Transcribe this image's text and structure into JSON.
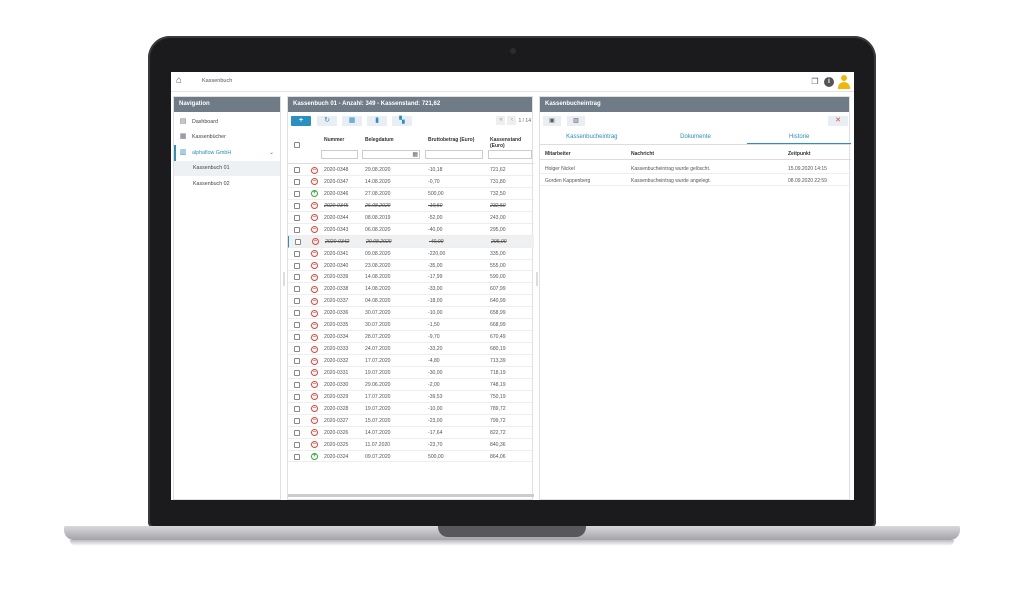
{
  "topbar": {
    "breadcrumb": "Kassenbuch"
  },
  "navigation": {
    "title": "Navigation",
    "items": [
      {
        "label": "Dashboard",
        "icon": "dashboard-icon"
      },
      {
        "label": "Kassenbücher",
        "icon": "cash-register-icon"
      },
      {
        "label": "alphaflow GmbH",
        "icon": "building-icon"
      },
      {
        "label": "Kassenbuch 01",
        "icon": ""
      },
      {
        "label": "Kassenbuch 02",
        "icon": ""
      }
    ]
  },
  "main": {
    "title": "Kassenbuch 01 - Anzahl: 349 - Kassenstand: 721,62",
    "pager": "1 / 14",
    "columns": [
      "Nummer",
      "Belegdatum",
      "Bruttobetrag (Euro)",
      "Kassenstand (Euro)"
    ],
    "rows": [
      {
        "nr": "2020-0348",
        "datum": "29.08.2020",
        "betrag": "-10,18",
        "stand": "721,62",
        "type": "minus",
        "strike": false,
        "sel": false
      },
      {
        "nr": "2020-0347",
        "datum": "14.08.2020",
        "betrag": "-0,70",
        "stand": "731,80",
        "type": "minus",
        "strike": false,
        "sel": false
      },
      {
        "nr": "2020-0346",
        "datum": "27.08.2020",
        "betrag": "500,00",
        "stand": "732,50",
        "type": "plus",
        "strike": false,
        "sel": false
      },
      {
        "nr": "2020-0345",
        "datum": "26.08.2020",
        "betrag": "-10,50",
        "stand": "232,50",
        "type": "minus",
        "strike": true,
        "sel": false
      },
      {
        "nr": "2020-0344",
        "datum": "08.08.2019",
        "betrag": "-52,00",
        "stand": "243,00",
        "type": "minus",
        "strike": false,
        "sel": false
      },
      {
        "nr": "2020-0343",
        "datum": "06.08.2020",
        "betrag": "-40,00",
        "stand": "295,00",
        "type": "minus",
        "strike": false,
        "sel": false
      },
      {
        "nr": "2020-0342",
        "datum": "20.08.2020",
        "betrag": "-40,00",
        "stand": "295,00",
        "type": "minus",
        "strike": true,
        "sel": true
      },
      {
        "nr": "2020-0341",
        "datum": "09.08.2020",
        "betrag": "-220,00",
        "stand": "335,00",
        "type": "minus",
        "strike": false,
        "sel": false
      },
      {
        "nr": "2020-0340",
        "datum": "23.08.2020",
        "betrag": "-35,00",
        "stand": "555,00",
        "type": "minus",
        "strike": false,
        "sel": false
      },
      {
        "nr": "2020-0339",
        "datum": "14.08.2020",
        "betrag": "-17,99",
        "stand": "590,00",
        "type": "minus",
        "strike": false,
        "sel": false
      },
      {
        "nr": "2020-0338",
        "datum": "14.08.2020",
        "betrag": "-33,00",
        "stand": "607,99",
        "type": "minus",
        "strike": false,
        "sel": false
      },
      {
        "nr": "2020-0337",
        "datum": "04.08.2020",
        "betrag": "-18,00",
        "stand": "640,99",
        "type": "minus",
        "strike": false,
        "sel": false
      },
      {
        "nr": "2020-0336",
        "datum": "30.07.2020",
        "betrag": "-10,00",
        "stand": "658,99",
        "type": "minus",
        "strike": false,
        "sel": false
      },
      {
        "nr": "2020-0335",
        "datum": "30.07.2020",
        "betrag": "-1,50",
        "stand": "668,99",
        "type": "minus",
        "strike": false,
        "sel": false
      },
      {
        "nr": "2020-0334",
        "datum": "28.07.2020",
        "betrag": "-9,70",
        "stand": "670,49",
        "type": "minus",
        "strike": false,
        "sel": false
      },
      {
        "nr": "2020-0333",
        "datum": "24.07.2020",
        "betrag": "-33,20",
        "stand": "680,19",
        "type": "minus",
        "strike": false,
        "sel": false
      },
      {
        "nr": "2020-0332",
        "datum": "17.07.2020",
        "betrag": "-4,80",
        "stand": "713,39",
        "type": "minus",
        "strike": false,
        "sel": false
      },
      {
        "nr": "2020-0331",
        "datum": "19.07.2020",
        "betrag": "-30,00",
        "stand": "718,19",
        "type": "minus",
        "strike": false,
        "sel": false
      },
      {
        "nr": "2020-0330",
        "datum": "29.06.2020",
        "betrag": "-2,00",
        "stand": "748,19",
        "type": "minus",
        "strike": false,
        "sel": false
      },
      {
        "nr": "2020-0329",
        "datum": "17.07.2020",
        "betrag": "-39,53",
        "stand": "750,19",
        "type": "minus",
        "strike": false,
        "sel": false
      },
      {
        "nr": "2020-0328",
        "datum": "19.07.2020",
        "betrag": "-10,00",
        "stand": "789,72",
        "type": "minus",
        "strike": false,
        "sel": false
      },
      {
        "nr": "2020-0327",
        "datum": "15.07.2020",
        "betrag": "-23,00",
        "stand": "799,72",
        "type": "minus",
        "strike": false,
        "sel": false
      },
      {
        "nr": "2020-0326",
        "datum": "14.07.2020",
        "betrag": "-17,64",
        "stand": "822,72",
        "type": "minus",
        "strike": false,
        "sel": false
      },
      {
        "nr": "2020-0325",
        "datum": "11.07.2020",
        "betrag": "-23,70",
        "stand": "840,36",
        "type": "minus",
        "strike": false,
        "sel": false
      },
      {
        "nr": "2020-0324",
        "datum": "09.07.2020",
        "betrag": "500,00",
        "stand": "864,06",
        "type": "plus",
        "strike": false,
        "sel": false
      }
    ]
  },
  "detail": {
    "title": "Kassenbucheintrag",
    "tabs": [
      "Kassenbucheintrag",
      "Dokumente",
      "Historie"
    ],
    "active_tab": 2,
    "columns": [
      "Mitarbeiter",
      "Nachricht",
      "Zeitpunkt"
    ],
    "rows": [
      {
        "mitarbeiter": "Holger Nickel",
        "nachricht": "Kassenbucheintrag wurde gelöscht.",
        "zeit": "15.09.2020 14:15"
      },
      {
        "mitarbeiter": "Gorden Kappenberg",
        "nachricht": "Kassenbucheintrag wurde angelegt.",
        "zeit": "08.09.2020 22:59"
      }
    ]
  },
  "colors": {
    "accent": "#2a8fc1",
    "header": "#6f7b86",
    "negative": "#e0443a",
    "positive": "#3aa83a",
    "user": "#f2b705"
  }
}
